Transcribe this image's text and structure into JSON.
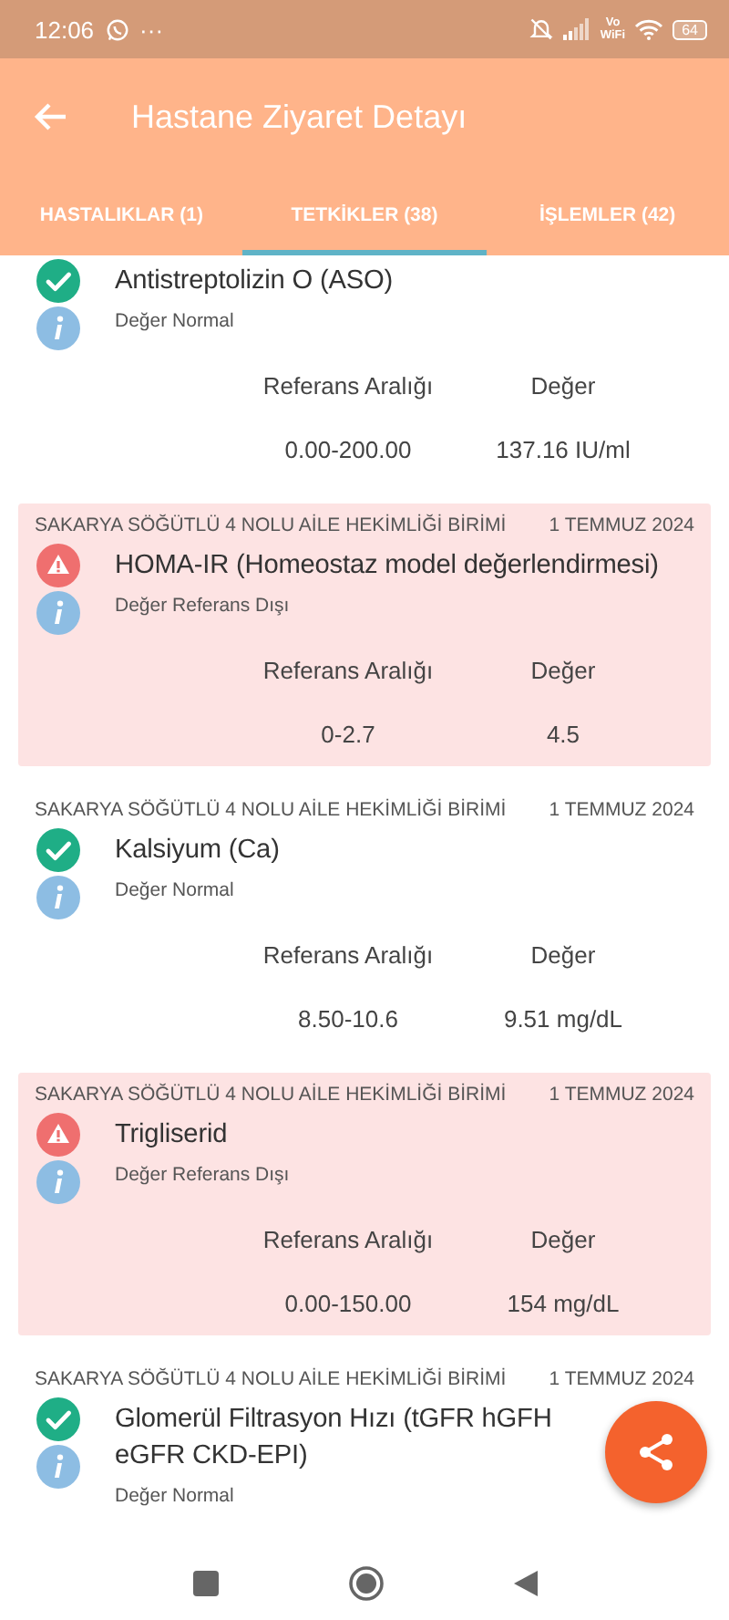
{
  "status_bar": {
    "time": "12:06",
    "more": "···",
    "volte_top": "Vo",
    "volte_bottom": "WiFi",
    "battery": "64"
  },
  "app_bar": {
    "title": "Hastane Ziyaret Detayı"
  },
  "tabs": [
    {
      "label": "HASTALIKLAR (1)",
      "selected": false
    },
    {
      "label": "TETKİKLER (38)",
      "selected": true
    },
    {
      "label": "İŞLEMLER (42)",
      "selected": false
    }
  ],
  "tests": [
    {
      "kind": "normal",
      "name": "Antistreptolizin O (ASO)",
      "note": "Değer Normal",
      "range_label": "Referans Aralığı",
      "value_label": "Değer",
      "range": "0.00-200.00",
      "value": "137.16 IU/ml"
    },
    {
      "kind": "abnormal",
      "unit": "SAKARYA SÖĞÜTLÜ 4 NOLU AİLE HEKİMLİĞİ BİRİMİ",
      "date": "1 TEMMUZ 2024",
      "name": "HOMA-IR (Homeostaz model değerlendirmesi)",
      "note": "Değer Referans Dışı",
      "range_label": "Referans Aralığı",
      "value_label": "Değer",
      "range": "0-2.7",
      "value": "4.5"
    },
    {
      "kind": "normal",
      "unit": "SAKARYA SÖĞÜTLÜ 4 NOLU AİLE HEKİMLİĞİ BİRİMİ",
      "date": "1 TEMMUZ 2024",
      "name": "Kalsiyum (Ca)",
      "note": "Değer Normal",
      "range_label": "Referans Aralığı",
      "value_label": "Değer",
      "range": "8.50-10.6",
      "value": "9.51 mg/dL"
    },
    {
      "kind": "abnormal",
      "unit": "SAKARYA SÖĞÜTLÜ 4 NOLU AİLE HEKİMLİĞİ BİRİMİ",
      "date": "1 TEMMUZ 2024",
      "name": "Trigliserid",
      "note": "Değer Referans Dışı",
      "range_label": "Referans Aralığı",
      "value_label": "Değer",
      "range": "0.00-150.00",
      "value": "154 mg/dL"
    },
    {
      "kind": "normal",
      "unit": "SAKARYA SÖĞÜTLÜ 4 NOLU AİLE HEKİMLİĞİ BİRİMİ",
      "date": "1 TEMMUZ 2024",
      "name": "Glomerül Filtrasyon Hızı (tGFR hGFH eGFR CKD-EPI)",
      "note": "Değer Normal"
    }
  ]
}
